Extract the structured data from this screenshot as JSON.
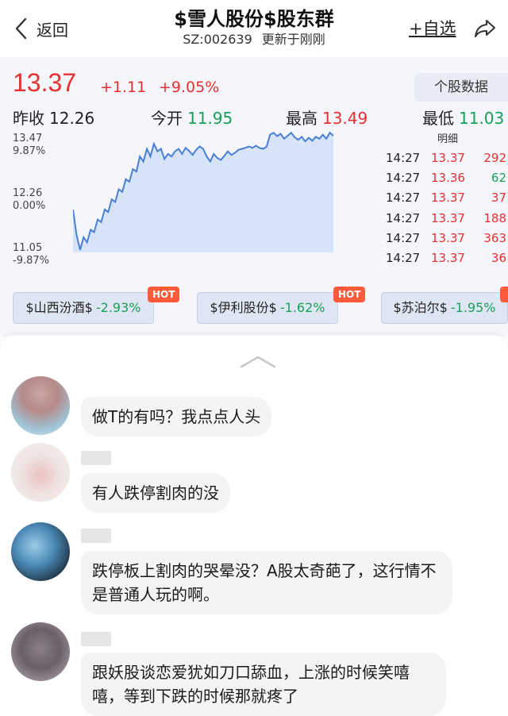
{
  "header": {
    "back_label": "返回",
    "title": "$雪人股份$股东群",
    "code": "SZ:002639",
    "updated": "更新于刚刚",
    "watch_label": "+自选"
  },
  "quote": {
    "price": "13.37",
    "change": "+1.11",
    "change_pct": "+9.05%",
    "detail_button": "个股数据",
    "stats": [
      {
        "key": "昨收",
        "value": "12.26",
        "color": "#222222"
      },
      {
        "key": "今开",
        "value": "11.95",
        "color": "#18a058"
      },
      {
        "key": "最高",
        "value": "13.49",
        "color": "#e93030"
      },
      {
        "key": "最低",
        "value": "11.03",
        "color": "#18a058"
      }
    ],
    "axis": {
      "high_price": "13.47",
      "high_pct": "9.87%",
      "mid_price": "12.26",
      "mid_pct": "0.00%",
      "low_price": "11.05",
      "low_pct": "-9.87%"
    },
    "ticks_header": "明细",
    "ticks": [
      {
        "time": "14:27",
        "price": "13.37",
        "volume": "292",
        "vol_color": "#e93030"
      },
      {
        "time": "14:27",
        "price": "13.36",
        "volume": "62",
        "vol_color": "#18a058"
      },
      {
        "time": "14:27",
        "price": "13.37",
        "volume": "37",
        "vol_color": "#e93030"
      },
      {
        "time": "14:27",
        "price": "13.37",
        "volume": "188",
        "vol_color": "#e93030"
      },
      {
        "time": "14:27",
        "price": "13.37",
        "volume": "363",
        "vol_color": "#e93030"
      },
      {
        "time": "14:27",
        "price": "13.37",
        "volume": "36",
        "vol_color": "#e93030"
      }
    ],
    "related": [
      {
        "name": "$山西汾酒$",
        "change": "-2.93%"
      },
      {
        "name": "$伊利股份$",
        "change": "-1.62%"
      },
      {
        "name": "$苏泊尔$",
        "change": "-1.95%"
      }
    ],
    "hot_label": "HOT"
  },
  "chart_data": {
    "type": "area",
    "title": "",
    "ylim": [
      11.05,
      13.47
    ],
    "baseline": 12.26,
    "values": [
      11.9,
      11.4,
      11.1,
      11.35,
      11.25,
      11.5,
      11.45,
      11.7,
      11.65,
      11.9,
      11.85,
      12.1,
      12.05,
      12.3,
      12.25,
      12.5,
      12.45,
      12.7,
      12.65,
      12.95,
      12.85,
      13.1,
      12.95,
      13.2,
      13.05,
      13.1,
      12.9,
      13.0,
      12.95,
      13.05,
      13.1,
      13.0,
      13.12,
      13.06,
      12.98,
      13.08,
      13.15,
      13.1,
      12.95,
      12.85,
      13.0,
      12.92,
      12.88,
      12.96,
      13.05,
      12.98,
      13.02,
      13.08,
      13.1,
      13.12,
      13.15,
      13.12,
      13.16,
      13.12,
      13.1,
      13.14,
      13.38,
      13.42,
      13.35,
      13.4,
      13.3,
      13.36,
      13.42,
      13.33,
      13.28,
      13.34,
      13.25,
      13.32,
      13.26,
      13.34,
      13.3,
      13.38,
      13.3,
      13.42,
      13.36
    ],
    "line_color": "#4a7fd6",
    "fill_color": "#d7e3f6"
  },
  "comments": [
    {
      "text": "做T的有吗？我点点人头"
    },
    {
      "text": "有人跌停割肉的没"
    },
    {
      "text": "跌停板上割肉的哭晕没？A股太奇葩了，这行情不是普通人玩的啊。"
    },
    {
      "text": "跟妖股谈恋爱犹如刀口舔血，上涨的时候笑嘻嘻，等到下跌的时候那就疼了"
    }
  ]
}
